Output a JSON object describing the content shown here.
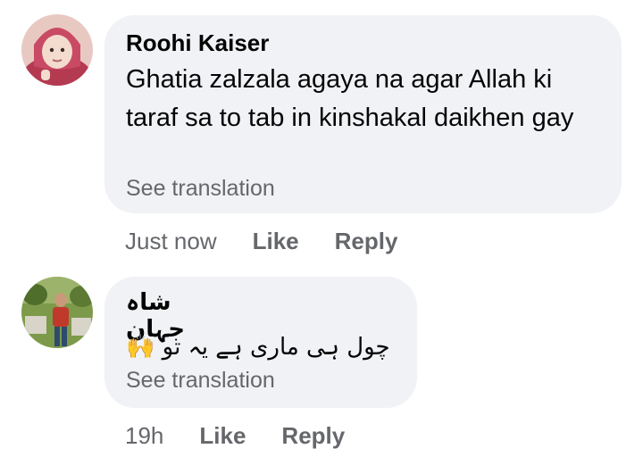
{
  "comments": [
    {
      "author": "Roohi Kaiser",
      "text": "Ghatia zalzala agaya na agar Allah ki taraf sa to tab in kinshakal daikhen gay",
      "see_translation": "See translation",
      "timestamp": "Just now",
      "like_label": "Like",
      "reply_label": "Reply",
      "avatar_icon": "child-avatar-icon",
      "colors": {
        "avatar_bg": "#c95a6a",
        "avatar_accent": "#f2d7c8"
      }
    },
    {
      "author": "شاہ جہان",
      "text": "چول ہی ماری ہے یہ تو 🙌",
      "see_translation": "See translation",
      "timestamp": "19h",
      "like_label": "Like",
      "reply_label": "Reply",
      "avatar_icon": "man-outdoor-avatar-icon",
      "colors": {
        "avatar_bg": "#6c8a3e",
        "avatar_accent": "#c0392b"
      }
    }
  ],
  "theme": {
    "bubble": "#f0f2f5",
    "muted": "#65676b",
    "text": "#050505"
  }
}
